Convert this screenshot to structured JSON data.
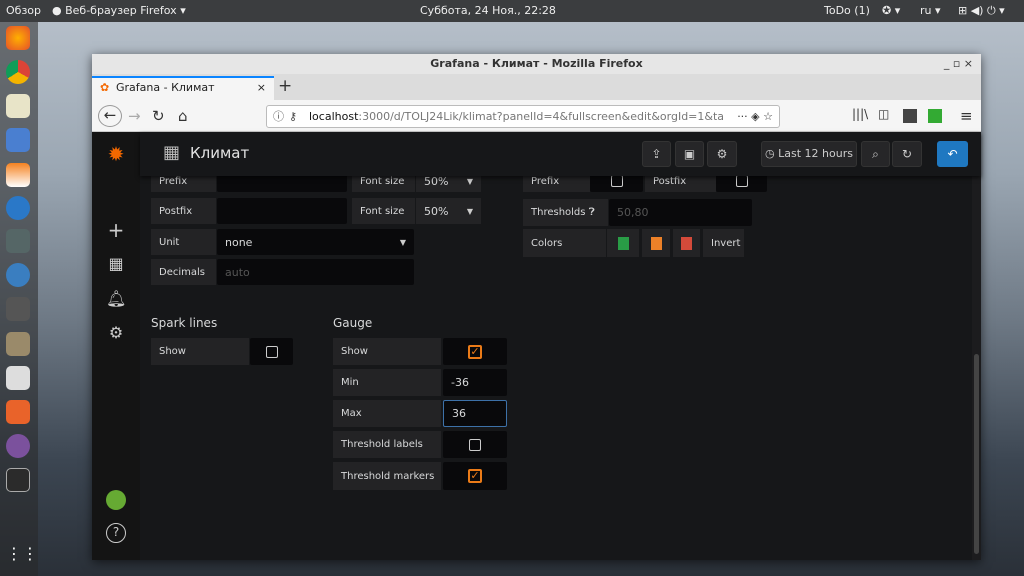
{
  "os": {
    "activities": "Обзор",
    "app_menu": "Веб-браузер Firefox",
    "clock": "Суббота, 24 Ноя., 22:28",
    "todo": "ToDo (1)",
    "lang": "ru"
  },
  "window": {
    "title": "Grafana - Климат - Mozilla Firefox",
    "tab": "Grafana - Климат",
    "url_host": "localhost",
    "url_path": ":3000/d/TOLJ24Lik/klimat?panelId=4&fullscreen&edit&orgId=1&ta"
  },
  "grafana": {
    "dashboard_title": "Климат",
    "time_range": "Last 12 hours"
  },
  "value_options": {
    "prefix_label": "Prefix",
    "prefix_font_label": "Font size",
    "prefix_font": "50%",
    "postfix_label": "Postfix",
    "postfix_font_label": "Font size",
    "postfix_font": "50%",
    "unit_label": "Unit",
    "unit": "none",
    "decimals_label": "Decimals",
    "decimals_placeholder": "auto"
  },
  "coloring": {
    "prefix_label": "Prefix",
    "postfix_label": "Postfix",
    "thresholds_label": "Thresholds",
    "thresholds_placeholder": "50,80",
    "colors_label": "Colors",
    "invert_label": "Invert",
    "colors": [
      "#299c46",
      "#ed8128",
      "#d44a3a"
    ]
  },
  "spark": {
    "title": "Spark lines",
    "show_label": "Show",
    "show": false
  },
  "gauge": {
    "title": "Gauge",
    "show_label": "Show",
    "show": true,
    "min_label": "Min",
    "min": "-36",
    "max_label": "Max",
    "max": "36",
    "threshold_labels_label": "Threshold labels",
    "threshold_labels": false,
    "threshold_markers_label": "Threshold markers",
    "threshold_markers": true
  }
}
